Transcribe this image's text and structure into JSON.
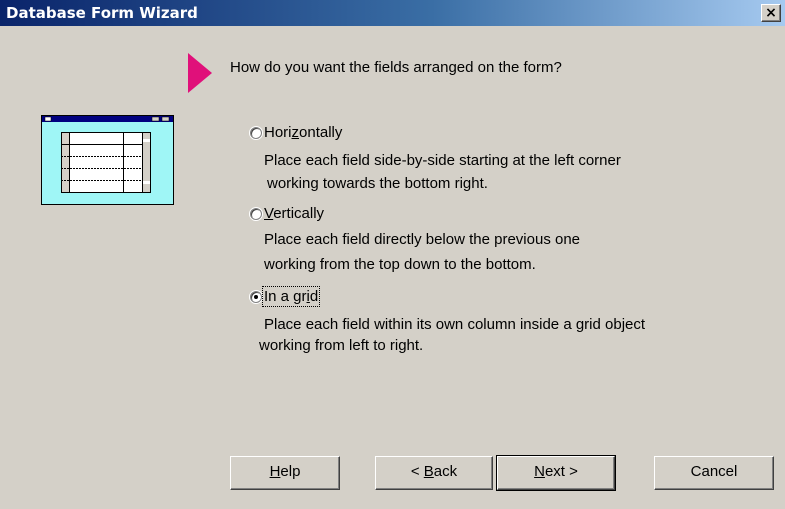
{
  "window": {
    "title": "Database Form Wizard",
    "close_label": "×"
  },
  "prompt": "How do you want the fields arranged on the form?",
  "options": [
    {
      "pre": "Hori",
      "key": "z",
      "post": "ontally",
      "desc": [
        "Place each field side-by-side starting at the left corner",
        "working towards the bottom right."
      ],
      "selected": false
    },
    {
      "pre": "",
      "key": "V",
      "post": "ertically",
      "desc": [
        "Place each field directly below the previous one",
        "working from the top down to the bottom."
      ],
      "selected": false
    },
    {
      "pre": "In a gr",
      "key": "i",
      "post": "d",
      "desc": [
        "Place each field within its own column inside a grid object",
        "working from left to right."
      ],
      "selected": true
    }
  ],
  "buttons": {
    "help": {
      "pre": "",
      "key": "H",
      "post": "elp"
    },
    "back": {
      "pre": "< ",
      "key": "B",
      "post": "ack"
    },
    "next": {
      "pre": "",
      "key": "N",
      "post": "ext >"
    },
    "cancel": {
      "label": "Cancel"
    }
  },
  "colors": {
    "title_start": "#0a246a",
    "title_end": "#a6caf0",
    "face": "#d4d0c8",
    "pointer": "#e0107a",
    "preview_fill": "#9ff6f6"
  },
  "icons": [
    "pointer-arrow-icon",
    "close-icon",
    "form-layout-preview-icon"
  ]
}
